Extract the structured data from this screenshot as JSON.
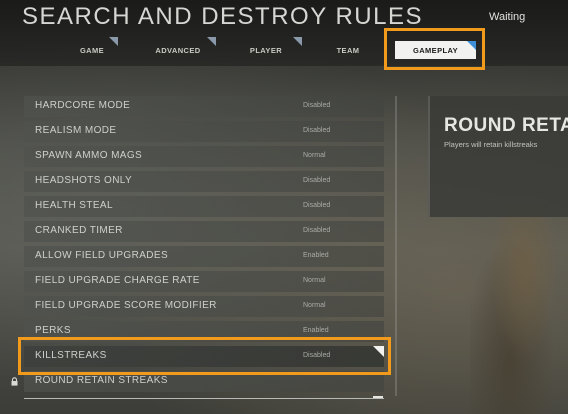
{
  "header": {
    "title": "SEARCH AND DESTROY RULES",
    "status": "Waiting"
  },
  "tabs": [
    {
      "label": "GAME",
      "active": false
    },
    {
      "label": "ADVANCED",
      "active": false
    },
    {
      "label": "PLAYER",
      "active": false
    },
    {
      "label": "TEAM",
      "active": false
    },
    {
      "label": "GAMEPLAY",
      "active": true
    }
  ],
  "rules": [
    {
      "label": "HARDCORE MODE",
      "value": "Disabled"
    },
    {
      "label": "REALISM MODE",
      "value": "Disabled"
    },
    {
      "label": "SPAWN AMMO MAGS",
      "value": "Normal"
    },
    {
      "label": "HEADSHOTS ONLY",
      "value": "Disabled"
    },
    {
      "label": "HEALTH STEAL",
      "value": "Disabled"
    },
    {
      "label": "CRANKED TIMER",
      "value": "Disabled"
    },
    {
      "label": "ALLOW FIELD UPGRADES",
      "value": "Enabled"
    },
    {
      "label": "FIELD UPGRADE CHARGE RATE",
      "value": "Normal"
    },
    {
      "label": "FIELD UPGRADE SCORE MODIFIER",
      "value": "Normal"
    },
    {
      "label": "PERKS",
      "value": "Enabled"
    },
    {
      "label": "KILLSTREAKS",
      "value": "Disabled",
      "selected": true
    },
    {
      "label": "ROUND RETAIN STREAKS",
      "value": "",
      "locked": true
    }
  ],
  "detail": {
    "title": "ROUND RETA",
    "description": "Players will retain killstreaks"
  },
  "colors": {
    "highlight": "#f29a1c",
    "active_tab_corner": "#3d8fd8"
  },
  "icons": {
    "lock": "lock-icon"
  }
}
